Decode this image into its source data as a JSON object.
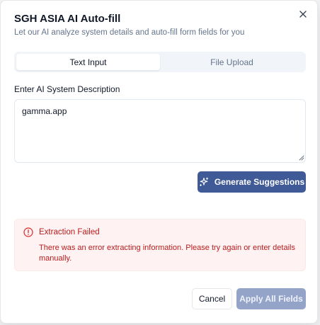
{
  "dialog": {
    "title": "SGH ASIA AI Auto-fill",
    "subtitle": "Let our AI analyze system details and auto-fill form fields for you",
    "close_icon": "close-icon"
  },
  "tabs": [
    {
      "label": "Text Input",
      "active": true
    },
    {
      "label": "File Upload",
      "active": false
    }
  ],
  "description_field": {
    "label": "Enter AI System Description",
    "value": "gamma.app"
  },
  "generate_button": {
    "label": "Generate Suggestions",
    "icon": "sparkles-icon"
  },
  "alert": {
    "icon": "alert-circle-icon",
    "title": "Extraction Failed",
    "message": "There was an error extracting information. Please try again or enter details manually."
  },
  "footer": {
    "cancel_label": "Cancel",
    "apply_label": "Apply All Fields",
    "apply_disabled": true
  },
  "colors": {
    "primary": "#3f5a97",
    "primary_disabled": "#94a3c8",
    "error_text": "#b91c1c",
    "error_bg": "#fef2f2"
  }
}
